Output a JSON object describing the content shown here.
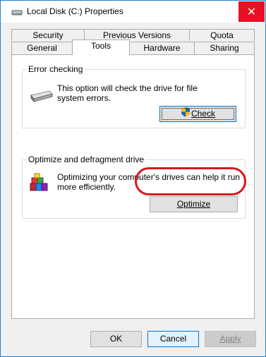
{
  "window": {
    "title": "Local Disk (C:) Properties",
    "close_glyph": "✕"
  },
  "tabs": {
    "row_back": [
      "Security",
      "Previous Versions",
      "Quota"
    ],
    "row_front": [
      "General",
      "Tools",
      "Hardware",
      "Sharing"
    ],
    "active": "Tools"
  },
  "error_checking": {
    "title": "Error checking",
    "description_line1": "This option will check the drive for file",
    "description_line2": "system errors.",
    "check_button_label": "Check"
  },
  "optimize": {
    "title": "Optimize and defragment drive",
    "description_line1": "Optimizing your computer's drives can help it run",
    "description_line2": "more efficiently.",
    "optimize_button_label": "Optimize"
  },
  "footer": {
    "ok_label": "OK",
    "cancel_label": "Cancel",
    "apply_label": "Apply"
  },
  "colors": {
    "accent": "#0078d7",
    "close_red": "#e81123",
    "highlight_red": "#d9161e"
  }
}
